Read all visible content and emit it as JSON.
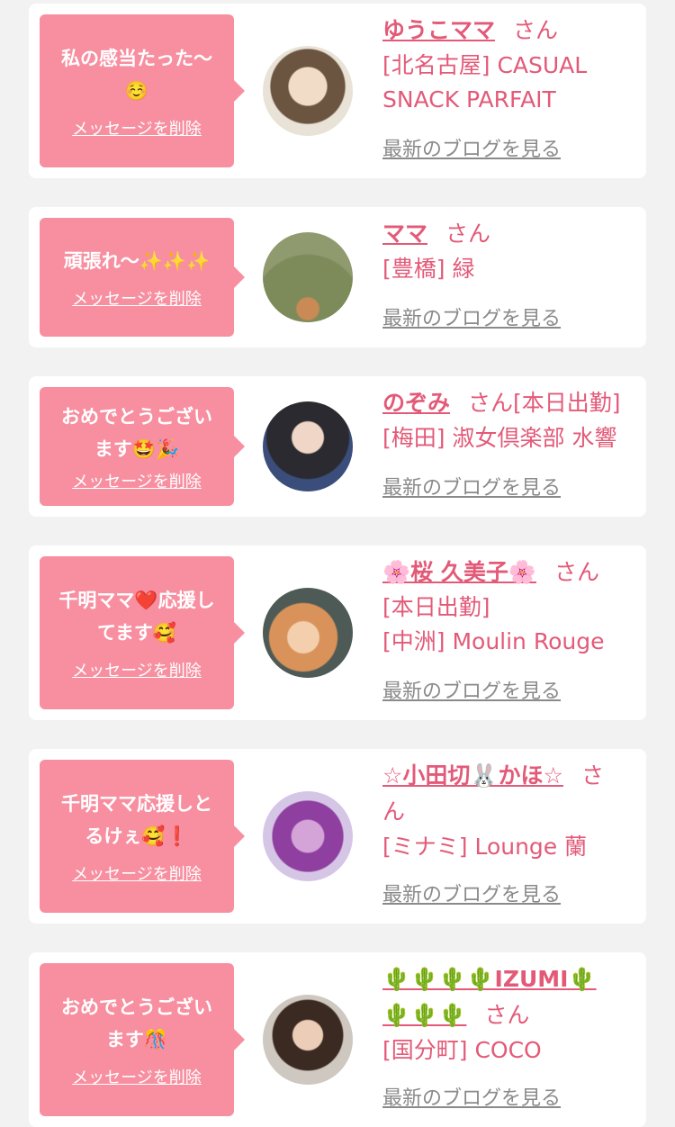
{
  "delete_label": "メッセージを削除",
  "blog_label": "最新のブログを見る",
  "san": "さん",
  "cards": [
    {
      "message_lines": [
        "私の感当たった〜",
        "☺️"
      ],
      "name": "ゆうこママ",
      "san": "さん",
      "extra": "",
      "shop_lines": [
        "[北名古屋] CASUAL",
        "SNACK PARFAIT"
      ]
    },
    {
      "message_lines": [
        "頑張れ〜✨✨✨"
      ],
      "name": "ママ",
      "san": "さん",
      "extra": "",
      "shop_lines": [
        "[豊橋] 緑"
      ]
    },
    {
      "message_lines": [
        "おめでとうござい",
        "ます🤩🎉"
      ],
      "name": "のぞみ",
      "san": "さん[本日出勤]",
      "extra": "",
      "shop_lines": [
        "[梅田] 淑女倶楽部 水響"
      ]
    },
    {
      "message_lines": [
        "千明ママ❤️応援し",
        "てます🥰"
      ],
      "name": "🌸桜 久美子🌸",
      "san": "さん",
      "extra": "[本日出勤]",
      "shop_lines": [
        "[中洲] Moulin Rouge"
      ]
    },
    {
      "message_lines": [
        "千明ママ応援しと",
        "るけぇ🥰❗"
      ],
      "name": "☆小田切🐰かほ☆",
      "san": "さ",
      "san2": "ん",
      "extra": "",
      "shop_lines": [
        "[ミナミ] Lounge 蘭"
      ]
    },
    {
      "message_lines": [
        "おめでとうござい",
        "ます🎊"
      ],
      "name": "🌵🌵🌵🌵IZUMI🌵",
      "name2": "🌵🌵🌵",
      "san": "さん",
      "extra": "",
      "shop_lines": [
        "[国分町] COCO"
      ]
    }
  ]
}
